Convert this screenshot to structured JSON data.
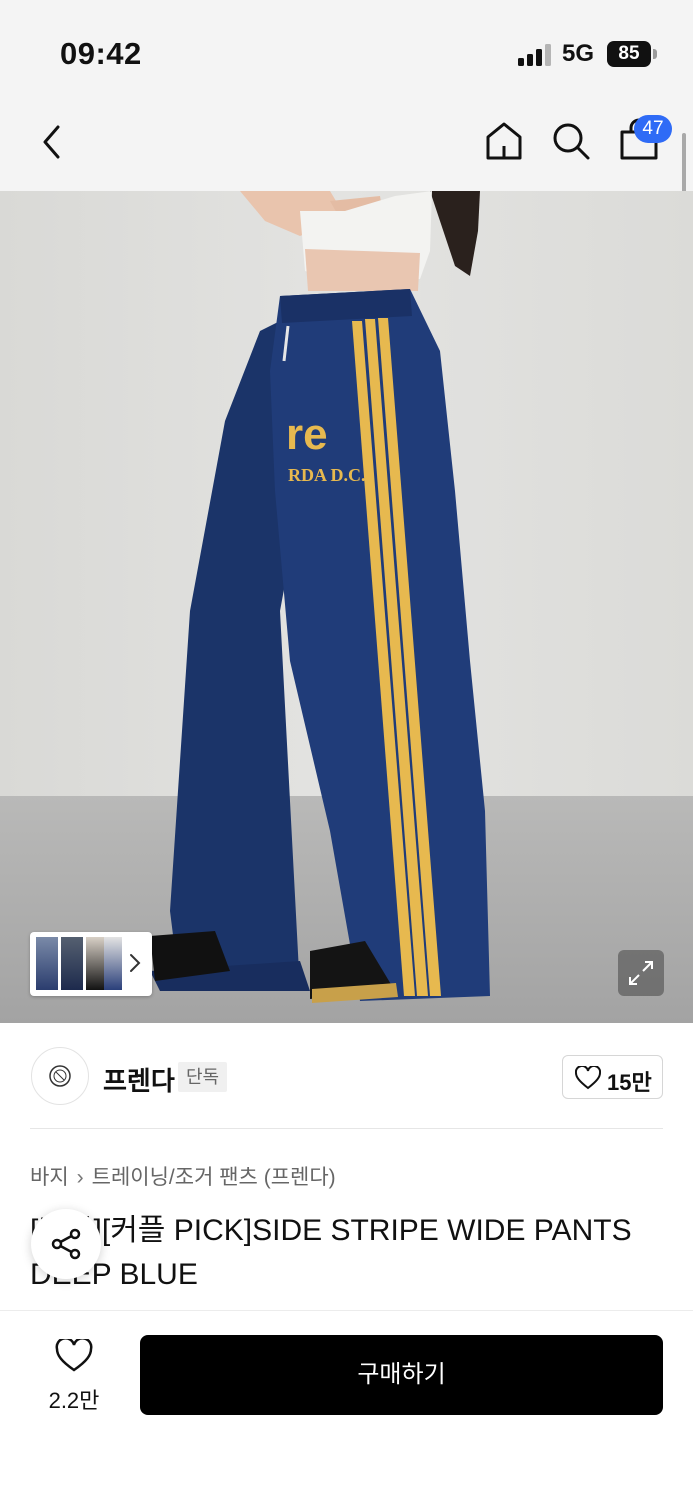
{
  "status_bar": {
    "time": "09:42",
    "network": "5G",
    "battery": "85"
  },
  "nav": {
    "back_icon": "chevron-left-icon",
    "home_icon": "home-icon",
    "search_icon": "search-icon",
    "cart_icon": "shopping-bag-icon",
    "cart_badge": "47",
    "badge_color": "#2f6bf6"
  },
  "hero": {
    "image_description_icon": "product-photo",
    "pants_color": "#1f3a73",
    "stripe_color": "#e7b94f",
    "expand_icon": "expand-icon",
    "thumbnail_icon": "chevron-right-icon"
  },
  "brand": {
    "name": "프렌다",
    "tag": "단독",
    "like_count": "15만",
    "logo_icon": "brand-logo-icon"
  },
  "product": {
    "category_parent": "바지",
    "category_child": "트레이닝/조거 팬츠 (프렌다)",
    "title": "[단독][커플 PICK]SIDE STRIPE WIDE PANTS DEEP BLUE",
    "share_icon": "share-icon"
  },
  "bottom": {
    "wish_count": "2.2만",
    "buy_label": "구매하기",
    "buy_color": "#000000"
  }
}
